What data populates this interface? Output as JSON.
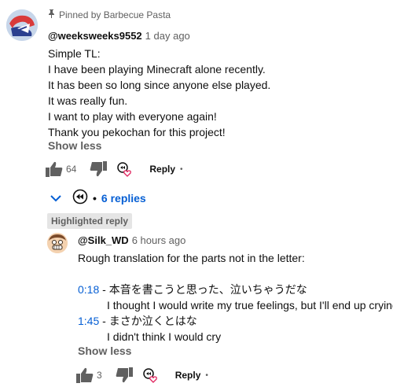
{
  "comment": {
    "pinned_text": "Pinned by Barbecue Pasta",
    "author": "@weeksweeks9552",
    "time": "1 day ago",
    "lines": [
      "Simple TL:",
      "I have been playing Minecraft alone recently.",
      "It has been so long since anyone else played.",
      "It was really fun.",
      "I want to play with everyone again!",
      "Thank you pekochan for this project!"
    ],
    "show_less": "Show less",
    "like_count": "64",
    "reply_label": "Reply",
    "dot": "•"
  },
  "replies": {
    "count_label": "6 replies",
    "bullet": "•"
  },
  "highlighted": {
    "badge": "Highlighted reply",
    "author": "@Silk_WD",
    "time": "6 hours ago",
    "intro": "Rough translation for the parts not in the letter:",
    "entries": [
      {
        "timestamp": "0:18",
        "jp": " - 本音を書こうと思った、泣いちゃうだな",
        "en": "I thought I would write my true feelings, but I'll end up crying"
      },
      {
        "timestamp": "1:45",
        "jp": " - まさか泣くとはな",
        "en": "I didn't think I would cry"
      }
    ],
    "show_less": "Show less",
    "like_count": "3",
    "reply_label": "Reply",
    "dot": "•"
  },
  "colors": {
    "link": "#065fd4",
    "secondary": "#606060",
    "text": "#0f0f0f"
  }
}
